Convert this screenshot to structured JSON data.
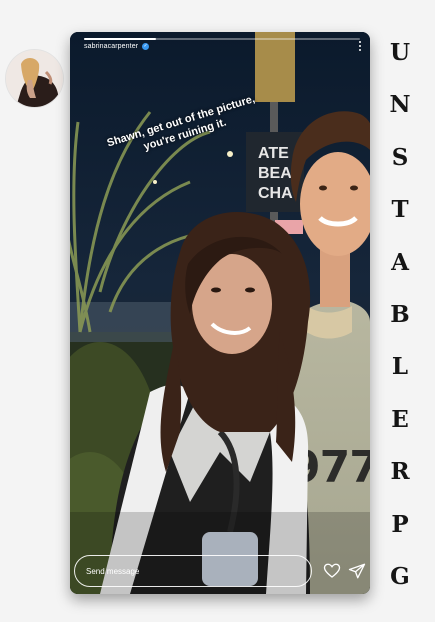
{
  "story": {
    "username": "sabrinacarpenter",
    "verified": true,
    "progress": 0.26,
    "caption_line1": "Shawn, get out of the picture,",
    "caption_line2": "you're ruining it.",
    "sign_lines": [
      "ATE",
      "BEA",
      "CHA"
    ],
    "jersey_number": "977",
    "message_placeholder": "Send message"
  },
  "side_title_letters": [
    "U",
    "N",
    "S",
    "T",
    "A",
    "B",
    "L",
    "E",
    "R",
    "P",
    "G"
  ],
  "icons": {
    "verified": "verified-badge-icon",
    "more": "more-options-icon",
    "heart": "heart-icon",
    "send": "send-icon"
  },
  "colors": {
    "verified_blue": "#3897f0",
    "side_title": "#151515"
  }
}
